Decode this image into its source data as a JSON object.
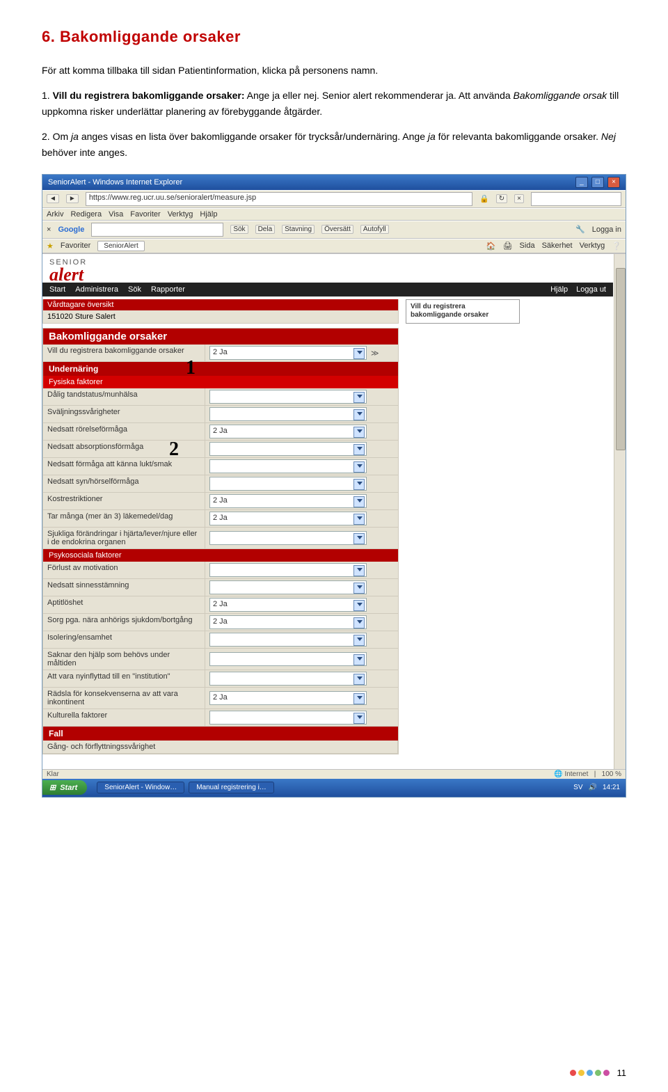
{
  "section_title": "6. Bakomliggande orsaker",
  "intro": "För att komma tillbaka till sidan Patientinformation, klicka på personens namn.",
  "step1": {
    "num": "1. ",
    "bold": "Vill du registrera bakomliggande orsaker:",
    "rest": " Ange ja eller nej. Senior alert rekommenderar ja. Att använda ",
    "italic": "Bakomliggande orsak",
    "rest2": " till uppkomna risker underlättar planering av förebyggande åtgärder."
  },
  "step2": {
    "num": "2. ",
    "text": "Om ",
    "i1": "ja",
    "text2": " anges visas en lista över bakomliggande orsaker för trycksår/undernäring. Ange ",
    "i2": "ja",
    "text3": " för relevanta bakomliggande orsaker. ",
    "i3": "Nej",
    "text4": " behöver inte anges."
  },
  "browser": {
    "title": "SeniorAlert - Windows Internet Explorer",
    "url": "https://www.reg.ucr.uu.se/senioralert/measure.jsp",
    "menus": [
      "Arkiv",
      "Redigera",
      "Visa",
      "Favoriter",
      "Verktyg",
      "Hjälp"
    ],
    "google_label": "Google",
    "toolbar_items": [
      "Sök",
      "Dela",
      "Stavning",
      "Översätt",
      "Autofyll"
    ],
    "login": "Logga in",
    "fav_label": "Favoriter",
    "fav_tab": "SeniorAlert",
    "fav_right": [
      "Sida",
      "Säkerhet",
      "Verktyg"
    ]
  },
  "app": {
    "logo_top": "SENIOR",
    "logo_bottom": "alert",
    "nav": [
      "Start",
      "Administrera",
      "Sök",
      "Rapporter"
    ],
    "nav_right": [
      "Hjälp",
      "Logga ut"
    ],
    "patient_header": "Vårdtagare översikt",
    "patient_id_name": "151020 Sture Salert",
    "side_title1": "Vill du registrera",
    "side_title2": "bakomliggande orsaker",
    "main_header": "Bakomliggande orsaker",
    "q_row_label": "Vill du registrera bakomliggande orsaker",
    "q_row_val": "2 Ja",
    "subheader1": "Undernäring",
    "group1": "Fysiska faktorer",
    "rows1": [
      {
        "label": "Dålig tandstatus/munhälsa",
        "val": ""
      },
      {
        "label": "Sväljningssvårigheter",
        "val": ""
      },
      {
        "label": "Nedsatt rörelseförmåga",
        "val": "2 Ja"
      },
      {
        "label": "Nedsatt absorptionsförmåga",
        "val": ""
      },
      {
        "label": "Nedsatt förmåga att känna lukt/smak",
        "val": ""
      },
      {
        "label": "Nedsatt syn/hörselförmåga",
        "val": ""
      },
      {
        "label": "Kostrestriktioner",
        "val": "2 Ja"
      },
      {
        "label": "Tar många (mer än 3) läkemedel/dag",
        "val": "2 Ja"
      },
      {
        "label": "Sjukliga förändringar i hjärta/lever/njure eller i de endokrina organen",
        "val": ""
      }
    ],
    "group2": "Psykosociala faktorer",
    "rows2": [
      {
        "label": "Förlust av motivation",
        "val": ""
      },
      {
        "label": "Nedsatt sinnesstämning",
        "val": ""
      },
      {
        "label": "Aptitlöshet",
        "val": "2 Ja"
      },
      {
        "label": "Sorg pga. nära anhörigs sjukdom/bortgång",
        "val": "2 Ja"
      },
      {
        "label": "Isolering/ensamhet",
        "val": ""
      },
      {
        "label": "Saknar den hjälp som behövs under måltiden",
        "val": ""
      },
      {
        "label": "Att vara nyinflyttad till en \"institution\"",
        "val": ""
      },
      {
        "label": "Rädsla för konsekvenserna av att vara inkontinent",
        "val": "2 Ja"
      },
      {
        "label": "Kulturella faktorer",
        "val": ""
      }
    ],
    "subheader2": "Fall",
    "fall_row": "Gång- och förflyttningssvårighet"
  },
  "status": {
    "left": "Klar",
    "right_zone": "Internet",
    "zoom": "100 %"
  },
  "taskbar": {
    "start": "Start",
    "items": [
      "SeniorAlert - Window…",
      "Manual registrering i…"
    ],
    "time": "14:21",
    "lang": "SV"
  },
  "annotations": {
    "a1": "1",
    "a2": "2"
  },
  "page_number": "11",
  "dot_colors": [
    "#e94b4b",
    "#f4c63b",
    "#5aa8e6",
    "#7cc26f",
    "#cc4fa3"
  ]
}
